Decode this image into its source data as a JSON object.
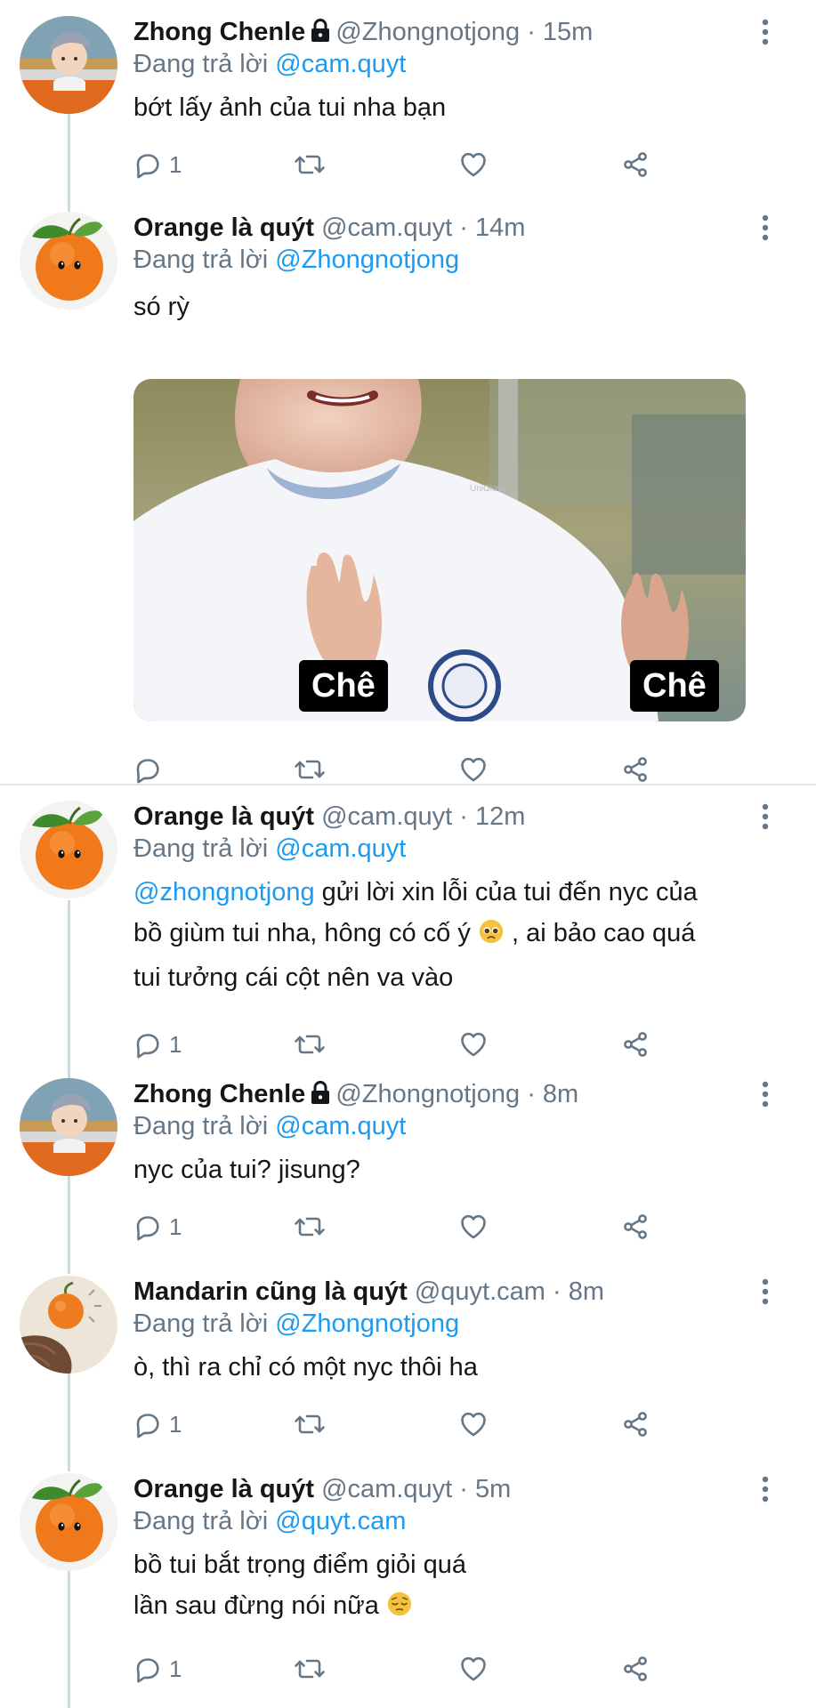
{
  "colors": {
    "accent": "#1d9bf0",
    "muted": "#657786",
    "text": "#14171a",
    "divider": "#e1e8ed"
  },
  "reply_prefix": "Đang trả lời",
  "tweets": [
    {
      "name": "Zhong Chenle",
      "handle": "@Zhongnotjong",
      "time": "15m",
      "reply_to": "@cam.quyt",
      "text_lines": [
        "bớt lấy ảnh của tui nha bạn"
      ],
      "reply_count": "1",
      "locked": true
    },
    {
      "name": "Orange là quýt",
      "handle": "@cam.quyt",
      "time": "14m",
      "reply_to": "@Zhongnotjong",
      "text_lines": [
        "só rỳ"
      ],
      "reply_count": "",
      "media": {
        "captions": [
          "Chê",
          "Chê"
        ],
        "watermark": "UniGlow"
      }
    },
    {
      "name": "Orange là quýt",
      "handle": "@cam.quyt",
      "time": "12m",
      "reply_to": "@cam.quyt",
      "mention_inline": "@zhongnotjong",
      "text_line1_rest": " gửi lời xin lỗi của tui đến nyc của",
      "text_line2_a": "bồ giùm tui nha, hông có cố ý ",
      "text_line2_b": " , ai bảo cao quá",
      "text_line3": "tui tưởng cái cột nên va vào",
      "emoji": "pleading-face-emoji",
      "reply_count": "1"
    },
    {
      "name": "Zhong Chenle",
      "handle": "@Zhongnotjong",
      "time": "8m",
      "reply_to": "@cam.quyt",
      "text_lines": [
        "nyc của tui? jisung?"
      ],
      "reply_count": "1",
      "locked": true
    },
    {
      "name": "Mandarin cũng là quýt",
      "handle": "@quyt.cam",
      "time": "8m",
      "reply_to": "@Zhongnotjong",
      "text_lines": [
        "ò, thì ra chỉ có một nyc thôi ha"
      ],
      "reply_count": "1"
    },
    {
      "name": "Orange là quýt",
      "handle": "@cam.quyt",
      "time": "5m",
      "reply_to": "@quyt.cam",
      "text_line1": "bồ tui bắt trọng điểm giỏi quá",
      "text_line2": "lần sau đừng nói nữa ",
      "emoji": "pensive-face-emoji",
      "reply_count": "1"
    }
  ]
}
